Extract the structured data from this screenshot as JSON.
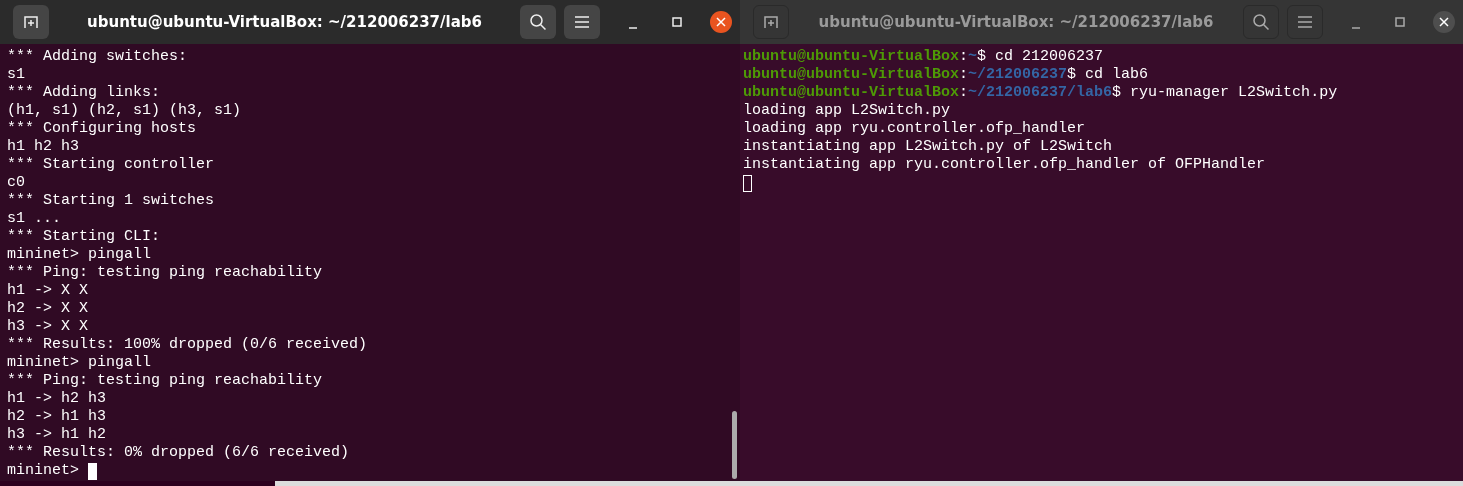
{
  "windows": [
    {
      "title": "ubuntu@ubuntu-VirtualBox: ~/212006237/lab6",
      "active": true,
      "lines": [
        {
          "kind": "text",
          "text": "*** Adding switches:"
        },
        {
          "kind": "text",
          "text": "s1"
        },
        {
          "kind": "text",
          "text": "*** Adding links:"
        },
        {
          "kind": "text",
          "text": "(h1, s1) (h2, s1) (h3, s1)"
        },
        {
          "kind": "text",
          "text": "*** Configuring hosts"
        },
        {
          "kind": "text",
          "text": "h1 h2 h3"
        },
        {
          "kind": "text",
          "text": "*** Starting controller"
        },
        {
          "kind": "text",
          "text": "c0"
        },
        {
          "kind": "text",
          "text": "*** Starting 1 switches"
        },
        {
          "kind": "text",
          "text": "s1 ..."
        },
        {
          "kind": "text",
          "text": "*** Starting CLI:"
        },
        {
          "kind": "text",
          "text": "mininet> pingall"
        },
        {
          "kind": "text",
          "text": "*** Ping: testing ping reachability"
        },
        {
          "kind": "text",
          "text": "h1 -> X X"
        },
        {
          "kind": "text",
          "text": "h2 -> X X"
        },
        {
          "kind": "text",
          "text": "h3 -> X X"
        },
        {
          "kind": "text",
          "text": "*** Results: 100% dropped (0/6 received)"
        },
        {
          "kind": "text",
          "text": "mininet> pingall"
        },
        {
          "kind": "text",
          "text": "*** Ping: testing ping reachability"
        },
        {
          "kind": "text",
          "text": "h1 -> h2 h3"
        },
        {
          "kind": "text",
          "text": "h2 -> h1 h3"
        },
        {
          "kind": "text",
          "text": "h3 -> h1 h2"
        },
        {
          "kind": "text",
          "text": "*** Results: 0% dropped (6/6 received)"
        },
        {
          "kind": "cursor",
          "text": "mininet>"
        }
      ]
    },
    {
      "title": "ubuntu@ubuntu-VirtualBox: ~/212006237/lab6",
      "active": false,
      "lines": [
        {
          "kind": "prompt",
          "user": "ubuntu@ubuntu-VirtualBox",
          "sep": ":",
          "path": "~",
          "command": "$ cd 212006237"
        },
        {
          "kind": "prompt",
          "user": "ubuntu@ubuntu-VirtualBox",
          "sep": ":",
          "path": "~/212006237",
          "command": "$ cd lab6"
        },
        {
          "kind": "prompt",
          "user": "ubuntu@ubuntu-VirtualBox",
          "sep": ":",
          "path": "~/212006237/lab6",
          "command": "$ ryu-manager L2Switch.py"
        },
        {
          "kind": "text",
          "text": "loading app L2Switch.py"
        },
        {
          "kind": "text",
          "text": "loading app ryu.controller.ofp_handler"
        },
        {
          "kind": "text",
          "text": "instantiating app L2Switch.py of L2Switch"
        },
        {
          "kind": "text",
          "text": "instantiating app ryu.controller.ofp_handler of OFPHandler"
        },
        {
          "kind": "cursor"
        }
      ]
    }
  ]
}
